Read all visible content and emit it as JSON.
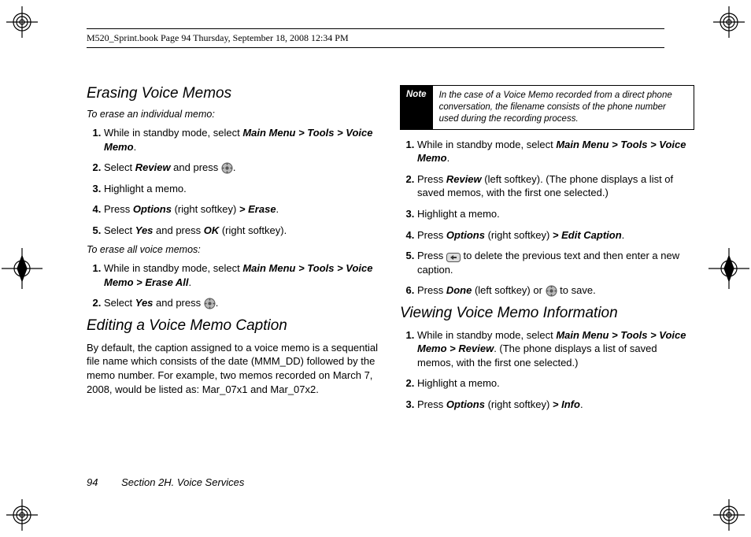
{
  "header": {
    "running_head": "M520_Sprint.book  Page 94  Thursday, September 18, 2008  12:34 PM"
  },
  "left": {
    "h1": "Erasing Voice Memos",
    "sub1": "To erase an individual memo:",
    "l1_1a": "While in standby mode, select ",
    "l1_1b": "Main Menu > Tools > Voice Memo",
    "l1_1c": ".",
    "l1_2a": "Select ",
    "l1_2b": "Review",
    "l1_2c": " and press ",
    "l1_2d": ".",
    "l1_3": "Highlight a memo.",
    "l1_4a": "Press ",
    "l1_4b": "Options",
    "l1_4c": " (right softkey) ",
    "l1_4d": "> Erase",
    "l1_4e": ".",
    "l1_5a": "Select ",
    "l1_5b": "Yes",
    "l1_5c": " and press ",
    "l1_5d": "OK",
    "l1_5e": " (right softkey).",
    "sub2": "To erase all voice memos:",
    "l2_1a": "While in standby mode, select ",
    "l2_1b": "Main Menu > Tools > Voice Memo > Erase All",
    "l2_1c": ".",
    "l2_2a": "Select ",
    "l2_2b": "Yes",
    "l2_2c": " and press ",
    "l2_2d": ".",
    "h2": "Editing a Voice Memo Caption",
    "para": "By default, the caption assigned to a voice memo is a sequential file name which consists of the date (MMM_DD) followed by the memo number. For example, two memos recorded on March 7, 2008, would be listed as: Mar_07x1 and Mar_07x2."
  },
  "right": {
    "note_label": "Note",
    "note_text": "In the case of a Voice Memo recorded from a direct phone conversation, the filename consists of the phone number used during the recording process.",
    "r1_1a": "While in standby mode, select ",
    "r1_1b": "Main Menu > Tools > Voice Memo",
    "r1_1c": ".",
    "r1_2a": "Press ",
    "r1_2b": "Review",
    "r1_2c": " (left softkey). (The phone displays a list of saved memos, with the first one selected.)",
    "r1_3": "Highlight a memo.",
    "r1_4a": "Press ",
    "r1_4b": "Options",
    "r1_4c": " (right softkey) ",
    "r1_4d": "> Edit Caption",
    "r1_4e": ".",
    "r1_5a": "Press ",
    "r1_5b": " to delete the previous text and then enter a new caption.",
    "r1_6a": "Press ",
    "r1_6b": "Done",
    "r1_6c": " (left softkey) or ",
    "r1_6d": " to save.",
    "h3": "Viewing Voice Memo Information",
    "r2_1a": "While in standby mode, select ",
    "r2_1b": "Main Menu > Tools > Voice Memo > Review",
    "r2_1c": ". (The phone displays a list of saved memos, with the first one selected.)",
    "r2_2": "Highlight a memo.",
    "r2_3a": "Press ",
    "r2_3b": "Options",
    "r2_3c": " (right softkey) ",
    "r2_3d": "> Info",
    "r2_3e": "."
  },
  "footer": {
    "page_number": "94",
    "section": "Section 2H. Voice Services"
  }
}
